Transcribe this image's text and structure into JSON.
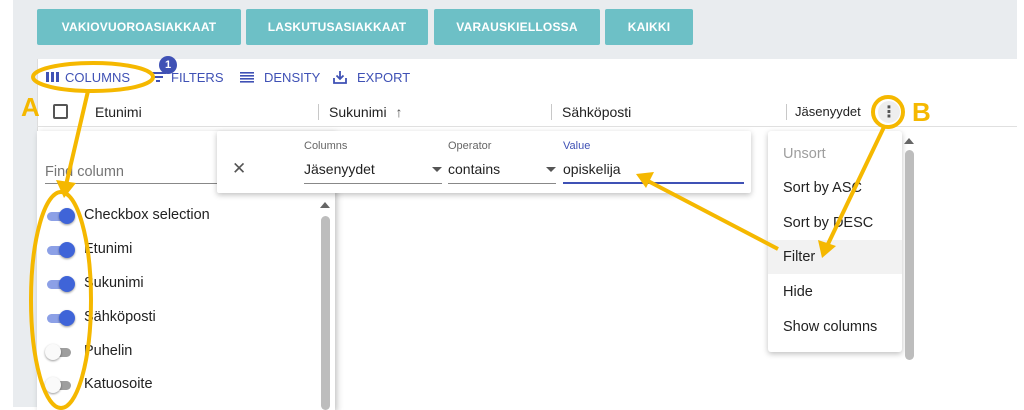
{
  "top_buttons": [
    "VAKIOVUOROASIAKKAAT",
    "LASKUTUSASIAKKAAT",
    "VARAUSKIELLOSSA",
    "KAIKKI"
  ],
  "toolbar": {
    "columns": "COLUMNS",
    "filters": "FILTERS",
    "filters_badge": "1",
    "density": "DENSITY",
    "export": "EXPORT"
  },
  "grid_headers": [
    "Etunimi",
    "Sukunimi",
    "Sähköposti",
    "Jäsenyydet"
  ],
  "filter_panel": {
    "columns_label": "Columns",
    "columns_value": "Jäsenyydet",
    "operator_label": "Operator",
    "operator_value": "contains",
    "value_label": "Value",
    "value_value": "opiskelija"
  },
  "column_panel": {
    "find_placeholder": "Find column",
    "columns": [
      {
        "label": "Checkbox selection",
        "on": true
      },
      {
        "label": "Etunimi",
        "on": true
      },
      {
        "label": "Sukunimi",
        "on": true
      },
      {
        "label": "Sähköposti",
        "on": true
      },
      {
        "label": "Puhelin",
        "on": false
      },
      {
        "label": "Katuosoite",
        "on": false
      }
    ]
  },
  "column_menu": [
    "Unsort",
    "Sort by ASC",
    "Sort by DESC",
    "Filter",
    "Hide",
    "Show columns"
  ],
  "callouts": [
    "A",
    "B"
  ],
  "colors": {
    "accent": "#3f51b5",
    "teal": "#6dc0c6",
    "callout": "#f5b800"
  }
}
